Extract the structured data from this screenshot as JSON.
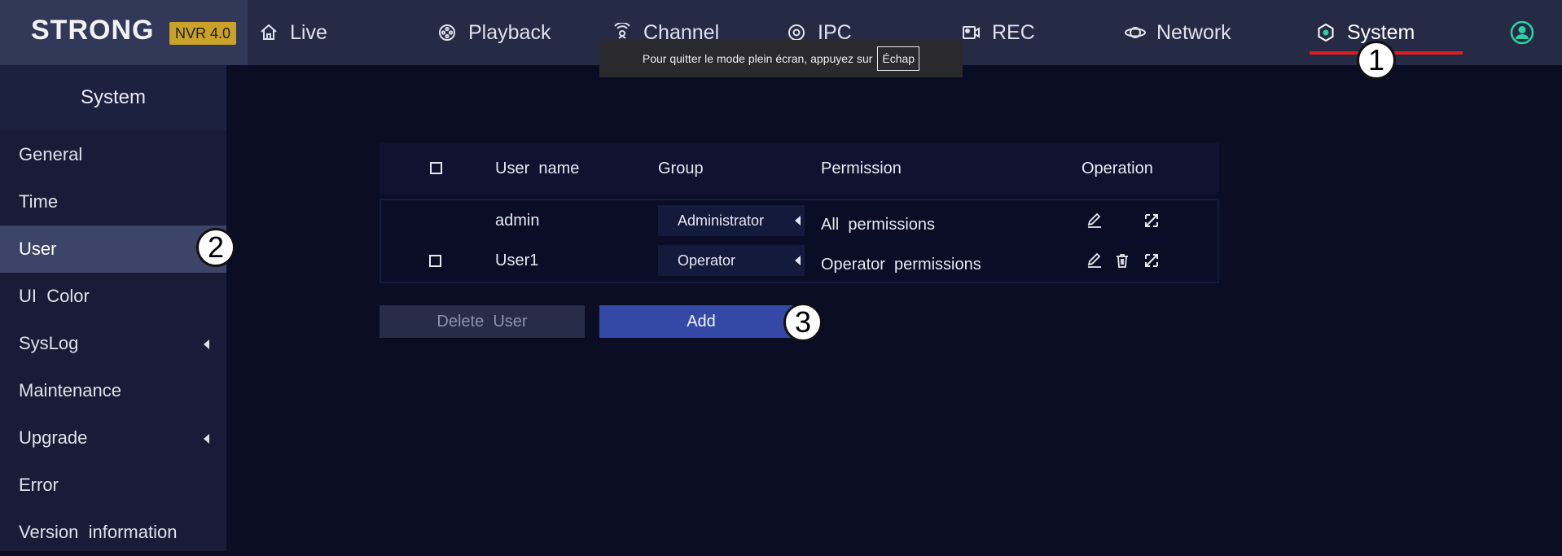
{
  "brand": {
    "name": "STRONG",
    "badge": "NVR 4.0",
    "badge_color": "#c9a227"
  },
  "nav": {
    "items": [
      {
        "label": "Live",
        "icon": "home-icon"
      },
      {
        "label": "Playback",
        "icon": "playback-reel-icon"
      },
      {
        "label": "Channel",
        "icon": "channel-icon"
      },
      {
        "label": "IPC",
        "icon": "ipc-camera-icon"
      },
      {
        "label": "REC",
        "icon": "record-icon"
      },
      {
        "label": "Network",
        "icon": "network-icon"
      },
      {
        "label": "System",
        "icon": "system-hexagon-icon",
        "active": true
      }
    ],
    "active_underline_color": "#e21d1d"
  },
  "toast": {
    "text": "Pour quitter le mode plein écran, appuyez sur",
    "key": "Échap"
  },
  "sidebar": {
    "title": "System",
    "items": [
      {
        "label": "General"
      },
      {
        "label": "Time"
      },
      {
        "label": "User",
        "active": true
      },
      {
        "label": "UI  Color"
      },
      {
        "label": "SysLog",
        "has_submenu": true
      },
      {
        "label": "Maintenance"
      },
      {
        "label": "Upgrade",
        "has_submenu": true
      },
      {
        "label": "Error"
      },
      {
        "label": "Version  information"
      }
    ]
  },
  "table": {
    "headers": {
      "username": "User  name",
      "group": "Group",
      "permission": "Permission",
      "operation": "Operation"
    },
    "rows": [
      {
        "username": "admin",
        "group": "Administrator",
        "permission": "All  permissions",
        "has_checkbox": false,
        "operations": [
          "edit-icon",
          "permission-settings-icon"
        ]
      },
      {
        "username": "User1",
        "group": "Operator",
        "permission": "Operator  permissions",
        "has_checkbox": true,
        "operations": [
          "edit-icon",
          "delete-icon",
          "permission-settings-icon"
        ]
      }
    ]
  },
  "buttons": {
    "delete": "Delete  User",
    "add": "Add"
  },
  "markers": [
    "1",
    "2",
    "3"
  ],
  "colors": {
    "accent_blue": "#3449a6",
    "background": "#0a0d24"
  }
}
